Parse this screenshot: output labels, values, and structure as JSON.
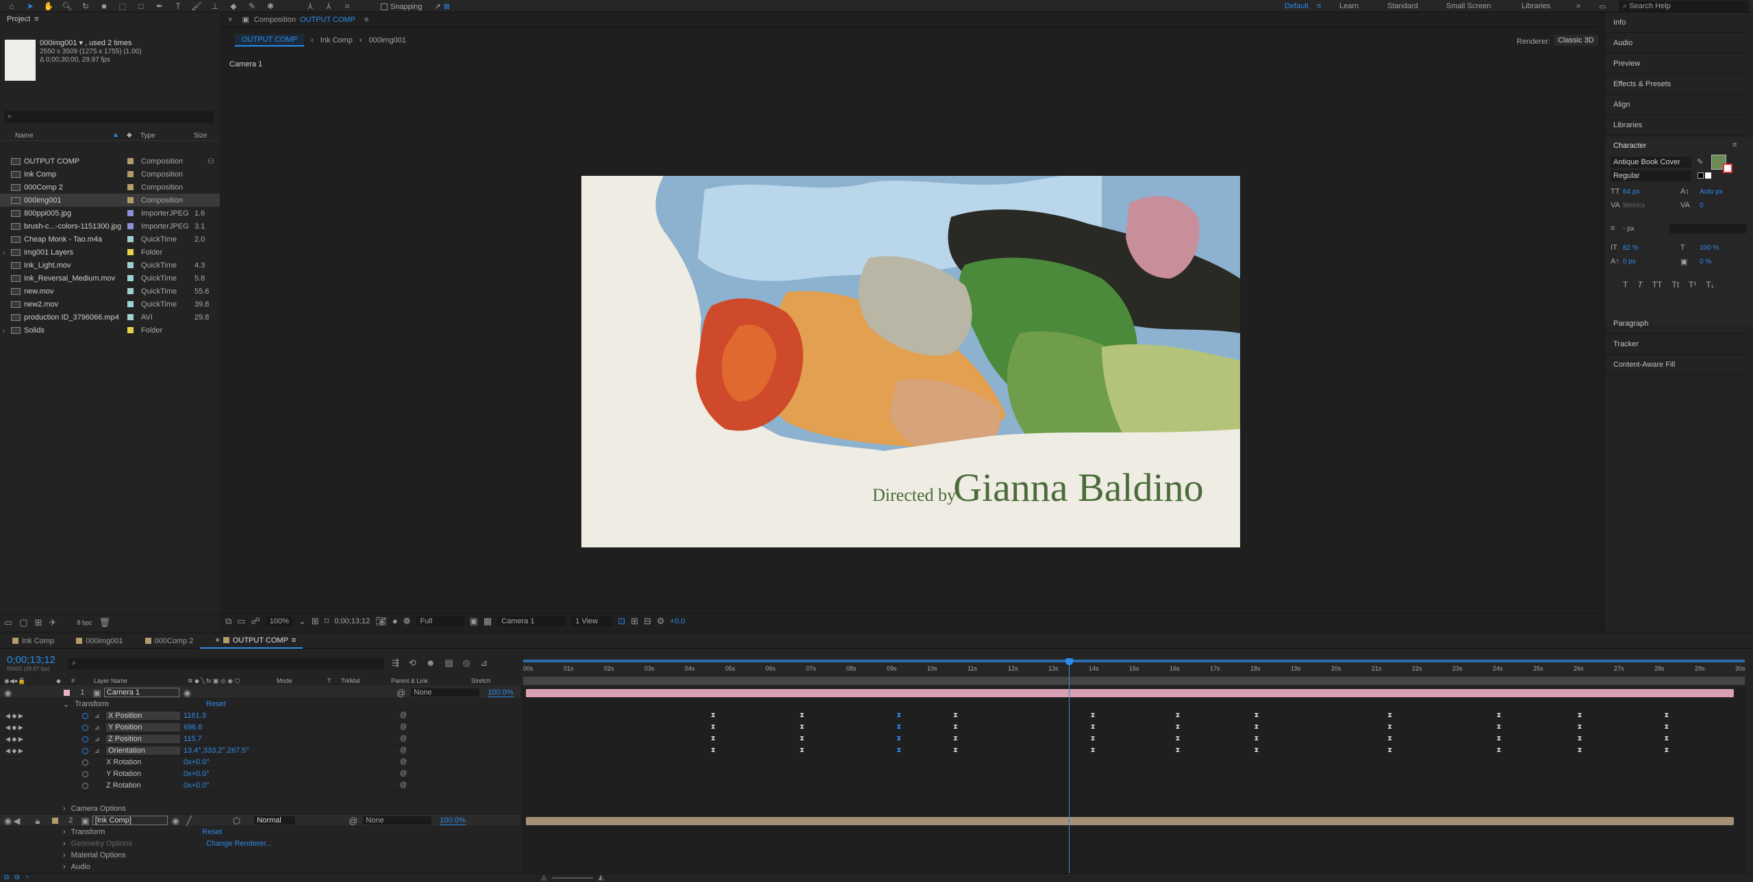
{
  "toolbar": {
    "snapping": "Snapping",
    "workspaces": [
      "Default",
      "Learn",
      "Standard",
      "Small Screen",
      "Libraries"
    ],
    "active_workspace": "Default",
    "search_placeholder": "Search Help"
  },
  "project": {
    "title": "Project",
    "item_name": "000img001 ▾ , used 2 times",
    "item_dims": "2550 x 3509  (1275 x 1755) (1.00)",
    "item_dur": "Δ 0;00;30;00, 29.97 fps",
    "columns": {
      "name": "Name",
      "type": "Type",
      "size": "Size"
    },
    "items": [
      {
        "name": "OUTPUT COMP",
        "type": "Composition",
        "size": "",
        "color": "#b39b6b"
      },
      {
        "name": "Ink Comp",
        "type": "Composition",
        "size": "",
        "color": "#b39b6b"
      },
      {
        "name": "000Comp 2",
        "type": "Composition",
        "size": "",
        "color": "#b39b6b"
      },
      {
        "name": "000img001",
        "type": "Composition",
        "size": "",
        "color": "#b39b6b"
      },
      {
        "name": "800ppi005.jpg",
        "type": "ImporterJPEG",
        "size": "1.6",
        "color": "#8e8ed6"
      },
      {
        "name": "brush-c...-colors-1151300.jpg",
        "type": "ImporterJPEG",
        "size": "3.1",
        "color": "#8e8ed6"
      },
      {
        "name": "Cheap Monk - Tao.m4a",
        "type": "QuickTime",
        "size": "2.0",
        "color": "#9fd0d0"
      },
      {
        "name": "img001 Layers",
        "type": "Folder",
        "size": "",
        "color": "#e8d24a"
      },
      {
        "name": "Ink_Light.mov",
        "type": "QuickTime",
        "size": "4.3",
        "color": "#9fd0d0"
      },
      {
        "name": "Ink_Reversal_Medium.mov",
        "type": "QuickTime",
        "size": "5.8",
        "color": "#9fd0d0"
      },
      {
        "name": "new.mov",
        "type": "QuickTime",
        "size": "55.6",
        "color": "#9fd0d0"
      },
      {
        "name": "new2.mov",
        "type": "QuickTime",
        "size": "39.8",
        "color": "#9fd0d0"
      },
      {
        "name": "production ID_3796066.mp4",
        "type": "AVI",
        "size": "29.8",
        "color": "#9fd0d0"
      },
      {
        "name": "Solids",
        "type": "Folder",
        "size": "",
        "color": "#e8d24a"
      }
    ],
    "bpc": "8 bpc"
  },
  "comp": {
    "title": "Composition",
    "title_blue": "OUTPUT COMP",
    "breadcrumbs": [
      "OUTPUT COMP",
      "Ink Comp",
      "000img001"
    ],
    "renderer_label": "Renderer:",
    "renderer": "Classic 3D",
    "camera_label": "Camera 1",
    "footer": {
      "zoom": "100%",
      "timecode": "0;00;13;12",
      "resolution": "Full",
      "camera": "Camera 1",
      "views": "1 View",
      "exposure": "+0.0"
    },
    "art_text": {
      "small": "Directed by",
      "large": "Gianna Baldino"
    }
  },
  "right_panel": {
    "items": [
      "Info",
      "Audio",
      "Preview",
      "Effects & Presets",
      "Align",
      "Libraries"
    ],
    "character": {
      "title": "Character",
      "font": "Antique Book Cover",
      "style": "Regular",
      "size": "64 px",
      "leading": "Auto px",
      "kerning": "Metrics",
      "tracking": "0",
      "stroke": "- px",
      "vscale": "82 %",
      "hscale": "100 %",
      "baseline": "0 px",
      "tsume": "0 %"
    },
    "items2": [
      "Paragraph",
      "Tracker",
      "Content-Aware Fill"
    ],
    "fill_color": "#6b8a55"
  },
  "timeline": {
    "tabs": [
      "Ink Comp",
      "000img001",
      "000Comp 2",
      "OUTPUT COMP"
    ],
    "timecode": "0;00;13;12",
    "frames": "00402 (29.97 fps)",
    "cols": {
      "layer_name": "Layer Name",
      "mode": "Mode",
      "t": "T",
      "trkmat": "TrkMat",
      "parent": "Parent & Link",
      "stretch": "Stretch"
    },
    "ruler": [
      "00s",
      "01s",
      "02s",
      "03s",
      "04s",
      "05s",
      "06s",
      "07s",
      "08s",
      "09s",
      "10s",
      "11s",
      "12s",
      "13s",
      "14s",
      "15s",
      "16s",
      "17s",
      "18s",
      "19s",
      "20s",
      "21s",
      "22s",
      "23s",
      "24s",
      "25s",
      "26s",
      "27s",
      "28s",
      "29s",
      "30s"
    ],
    "current_time_s": 13.4,
    "duration_s": 30,
    "layer1": {
      "num": "1",
      "name": "Camera 1",
      "parent": "None",
      "stretch": "100.0%",
      "transform": "Transform",
      "reset": "Reset",
      "props": [
        {
          "name": "X Position",
          "value": "1161.3"
        },
        {
          "name": "Y Position",
          "value": "696.6"
        },
        {
          "name": "Z Position",
          "value": "115.7"
        },
        {
          "name": "Orientation",
          "value": "13.4°,333.2°,267.5°"
        },
        {
          "name": "X Rotation",
          "value": "0x+0.0°"
        },
        {
          "name": "Y Rotation",
          "value": "0x+0.0°"
        },
        {
          "name": "Z Rotation",
          "value": "0x+0.0°"
        }
      ],
      "camera_options": "Camera Options",
      "keyframes_s": [
        4.6,
        6.8,
        9.2,
        10.6,
        14.0,
        16.1,
        18.05,
        21.35,
        24.05,
        26.05,
        28.2
      ],
      "selected_kf_s": 9.2
    },
    "layer2": {
      "num": "2",
      "name": "[Ink Comp]",
      "mode": "Normal",
      "parent": "None",
      "stretch": "100.0%",
      "transform": "Transform",
      "reset": "Reset",
      "geometry": "Geometry Options",
      "renderer_link": "Change Renderer...",
      "material": "Material Options",
      "audio": "Audio"
    }
  }
}
